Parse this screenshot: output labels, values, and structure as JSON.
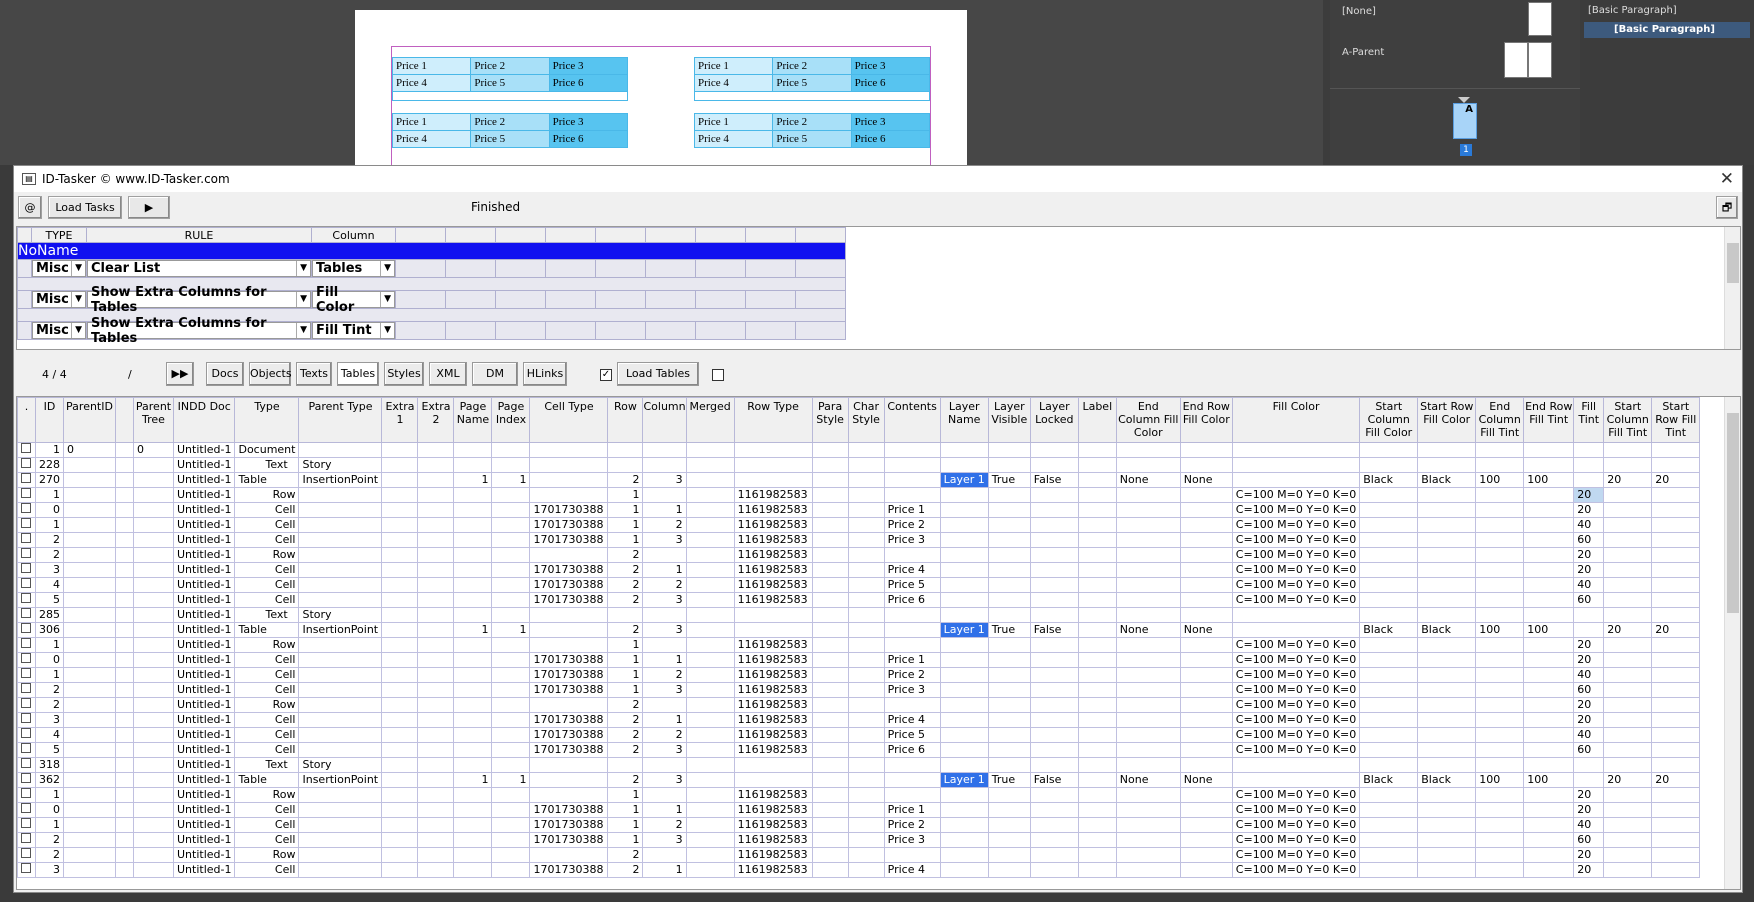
{
  "indesign": {
    "mini_tables": [
      [
        [
          "Price 1",
          "Price 2",
          "Price 3"
        ],
        [
          "Price 4",
          "Price 5",
          "Price 6"
        ]
      ],
      [
        [
          "Price 1",
          "Price 2",
          "Price 3"
        ],
        [
          "Price 4",
          "Price 5",
          "Price 6"
        ]
      ],
      [
        [
          "Price 1",
          "Price 2",
          "Price 3"
        ],
        [
          "Price 4",
          "Price 5",
          "Price 6"
        ]
      ],
      [
        [
          "Price 1",
          "Price 2",
          "Price 3"
        ],
        [
          "Price 4",
          "Price 5",
          "Price 6"
        ]
      ]
    ],
    "pages_panel": {
      "none_label": "[None]",
      "parent_label": "A-Parent",
      "page_marker": "A",
      "page_number": "1"
    },
    "styles_panel": {
      "item1": "[Basic Paragraph]",
      "item2": "[Basic Paragraph]"
    }
  },
  "window": {
    "title": "ID-Tasker  © www.ID-Tasker.com",
    "close": "✕"
  },
  "toolbar": {
    "at_label": "@",
    "load_tasks": "Load Tasks",
    "play": "▶",
    "status": "Finished",
    "restore": "🗗"
  },
  "rules": {
    "headers": [
      "TYPE",
      "RULE",
      "Column"
    ],
    "group": "NoName",
    "rows": [
      {
        "type": "Misc",
        "rule": "Clear List",
        "column": "Tables"
      },
      {
        "type": "Misc",
        "rule": "Show Extra Columns for Tables",
        "column": "Fill Color"
      },
      {
        "type": "Misc",
        "rule": "Show Extra Columns for Tables",
        "column": "Fill Tint"
      }
    ]
  },
  "tabs_bar": {
    "counter": "4 / 4",
    "slash": "/",
    "ff": "▶▶",
    "tabs": [
      "Docs",
      "Objects",
      "Texts",
      "Tables",
      "Styles",
      "XML",
      "DM",
      "HLinks"
    ],
    "selected": "Tables",
    "load_tables": "Load Tables",
    "check1": "✓"
  },
  "grid": {
    "headers": [
      ".",
      "ID",
      "ParentID",
      "",
      "Parent Tree",
      "INDD Doc",
      "Type",
      "Parent Type",
      "Extra 1",
      "Extra 2",
      "Page Name",
      "Page Index",
      "Cell Type",
      "Row",
      "Column",
      "Merged",
      "Row Type",
      "Para Style",
      "Char Style",
      "Contents",
      "Layer Name",
      "Layer Visible",
      "Layer Locked",
      "Label",
      "End Column Fill Color",
      "End Row Fill Color",
      "Fill Color",
      "Start Column Fill Color",
      "Start Row Fill Color",
      "End Column Fill Tint",
      "End Row Fill Tint",
      "Fill Tint",
      "Start Column Fill Tint",
      "Start Row Fill Tint"
    ],
    "rows": [
      {
        "id": "1",
        "pid": "0",
        "ptree": "0",
        "doc": "Untitled-1",
        "type": "Document"
      },
      {
        "id": "228",
        "doc": "Untitled-1",
        "type": "Text",
        "ptype": "Story"
      },
      {
        "id": "270",
        "doc": "Untitled-1",
        "type": "Table",
        "ptype": "InsertionPoint",
        "pname": "1",
        "pidx": "1",
        "row": "2",
        "col": "3",
        "layer": "Layer 1",
        "lvis": "True",
        "llock": "False",
        "ecfc": "None",
        "erfc": "None",
        "scfc": "Black",
        "srfc": "Black",
        "ecft": "100",
        "erft": "100",
        "scft": "20",
        "srft": "20"
      },
      {
        "id": "1",
        "doc": "Untitled-1",
        "type": "Row",
        "row": "1",
        "rtype": "1161982583",
        "fc": "C=100 M=0 Y=0 K=0",
        "ft": "20",
        "sel": true
      },
      {
        "id": "0",
        "doc": "Untitled-1",
        "type": "Cell",
        "ctype": "1701730388",
        "row": "1",
        "col": "1",
        "rtype": "1161982583",
        "cont": "Price 1",
        "fc": "C=100 M=0 Y=0 K=0",
        "ft": "20"
      },
      {
        "id": "1",
        "doc": "Untitled-1",
        "type": "Cell",
        "ctype": "1701730388",
        "row": "1",
        "col": "2",
        "rtype": "1161982583",
        "cont": "Price 2",
        "fc": "C=100 M=0 Y=0 K=0",
        "ft": "40"
      },
      {
        "id": "2",
        "doc": "Untitled-1",
        "type": "Cell",
        "ctype": "1701730388",
        "row": "1",
        "col": "3",
        "rtype": "1161982583",
        "cont": "Price 3",
        "fc": "C=100 M=0 Y=0 K=0",
        "ft": "60"
      },
      {
        "id": "2",
        "doc": "Untitled-1",
        "type": "Row",
        "row": "2",
        "rtype": "1161982583",
        "fc": "C=100 M=0 Y=0 K=0",
        "ft": "20"
      },
      {
        "id": "3",
        "doc": "Untitled-1",
        "type": "Cell",
        "ctype": "1701730388",
        "row": "2",
        "col": "1",
        "rtype": "1161982583",
        "cont": "Price 4",
        "fc": "C=100 M=0 Y=0 K=0",
        "ft": "20"
      },
      {
        "id": "4",
        "doc": "Untitled-1",
        "type": "Cell",
        "ctype": "1701730388",
        "row": "2",
        "col": "2",
        "rtype": "1161982583",
        "cont": "Price 5",
        "fc": "C=100 M=0 Y=0 K=0",
        "ft": "40"
      },
      {
        "id": "5",
        "doc": "Untitled-1",
        "type": "Cell",
        "ctype": "1701730388",
        "row": "2",
        "col": "3",
        "rtype": "1161982583",
        "cont": "Price 6",
        "fc": "C=100 M=0 Y=0 K=0",
        "ft": "60"
      },
      {
        "id": "285",
        "doc": "Untitled-1",
        "type": "Text",
        "ptype": "Story"
      },
      {
        "id": "306",
        "doc": "Untitled-1",
        "type": "Table",
        "ptype": "InsertionPoint",
        "pname": "1",
        "pidx": "1",
        "row": "2",
        "col": "3",
        "layer": "Layer 1",
        "lvis": "True",
        "llock": "False",
        "ecfc": "None",
        "erfc": "None",
        "scfc": "Black",
        "srfc": "Black",
        "ecft": "100",
        "erft": "100",
        "scft": "20",
        "srft": "20"
      },
      {
        "id": "1",
        "doc": "Untitled-1",
        "type": "Row",
        "row": "1",
        "rtype": "1161982583",
        "fc": "C=100 M=0 Y=0 K=0",
        "ft": "20"
      },
      {
        "id": "0",
        "doc": "Untitled-1",
        "type": "Cell",
        "ctype": "1701730388",
        "row": "1",
        "col": "1",
        "rtype": "1161982583",
        "cont": "Price 1",
        "fc": "C=100 M=0 Y=0 K=0",
        "ft": "20"
      },
      {
        "id": "1",
        "doc": "Untitled-1",
        "type": "Cell",
        "ctype": "1701730388",
        "row": "1",
        "col": "2",
        "rtype": "1161982583",
        "cont": "Price 2",
        "fc": "C=100 M=0 Y=0 K=0",
        "ft": "40"
      },
      {
        "id": "2",
        "doc": "Untitled-1",
        "type": "Cell",
        "ctype": "1701730388",
        "row": "1",
        "col": "3",
        "rtype": "1161982583",
        "cont": "Price 3",
        "fc": "C=100 M=0 Y=0 K=0",
        "ft": "60"
      },
      {
        "id": "2",
        "doc": "Untitled-1",
        "type": "Row",
        "row": "2",
        "rtype": "1161982583",
        "fc": "C=100 M=0 Y=0 K=0",
        "ft": "20"
      },
      {
        "id": "3",
        "doc": "Untitled-1",
        "type": "Cell",
        "ctype": "1701730388",
        "row": "2",
        "col": "1",
        "rtype": "1161982583",
        "cont": "Price 4",
        "fc": "C=100 M=0 Y=0 K=0",
        "ft": "20"
      },
      {
        "id": "4",
        "doc": "Untitled-1",
        "type": "Cell",
        "ctype": "1701730388",
        "row": "2",
        "col": "2",
        "rtype": "1161982583",
        "cont": "Price 5",
        "fc": "C=100 M=0 Y=0 K=0",
        "ft": "40"
      },
      {
        "id": "5",
        "doc": "Untitled-1",
        "type": "Cell",
        "ctype": "1701730388",
        "row": "2",
        "col": "3",
        "rtype": "1161982583",
        "cont": "Price 6",
        "fc": "C=100 M=0 Y=0 K=0",
        "ft": "60"
      },
      {
        "id": "318",
        "doc": "Untitled-1",
        "type": "Text",
        "ptype": "Story"
      },
      {
        "id": "362",
        "doc": "Untitled-1",
        "type": "Table",
        "ptype": "InsertionPoint",
        "pname": "1",
        "pidx": "1",
        "row": "2",
        "col": "3",
        "layer": "Layer 1",
        "lvis": "True",
        "llock": "False",
        "ecfc": "None",
        "erfc": "None",
        "scfc": "Black",
        "srfc": "Black",
        "ecft": "100",
        "erft": "100",
        "scft": "20",
        "srft": "20"
      },
      {
        "id": "1",
        "doc": "Untitled-1",
        "type": "Row",
        "row": "1",
        "rtype": "1161982583",
        "fc": "C=100 M=0 Y=0 K=0",
        "ft": "20"
      },
      {
        "id": "0",
        "doc": "Untitled-1",
        "type": "Cell",
        "ctype": "1701730388",
        "row": "1",
        "col": "1",
        "rtype": "1161982583",
        "cont": "Price 1",
        "fc": "C=100 M=0 Y=0 K=0",
        "ft": "20"
      },
      {
        "id": "1",
        "doc": "Untitled-1",
        "type": "Cell",
        "ctype": "1701730388",
        "row": "1",
        "col": "2",
        "rtype": "1161982583",
        "cont": "Price 2",
        "fc": "C=100 M=0 Y=0 K=0",
        "ft": "40"
      },
      {
        "id": "2",
        "doc": "Untitled-1",
        "type": "Cell",
        "ctype": "1701730388",
        "row": "1",
        "col": "3",
        "rtype": "1161982583",
        "cont": "Price 3",
        "fc": "C=100 M=0 Y=0 K=0",
        "ft": "60"
      },
      {
        "id": "2",
        "doc": "Untitled-1",
        "type": "Row",
        "row": "2",
        "rtype": "1161982583",
        "fc": "C=100 M=0 Y=0 K=0",
        "ft": "20"
      },
      {
        "id": "3",
        "doc": "Untitled-1",
        "type": "Cell",
        "ctype": "1701730388",
        "row": "2",
        "col": "1",
        "rtype": "1161982583",
        "cont": "Price 4",
        "fc": "C=100 M=0 Y=0 K=0",
        "ft": "20"
      }
    ]
  },
  "colors": {
    "noname_bg": "#1010f0",
    "layer_bg": "#3070e8",
    "cell_light": "#cfeefc",
    "cell_mid": "#a8e0f8",
    "cell_dark": "#57c4f0"
  }
}
